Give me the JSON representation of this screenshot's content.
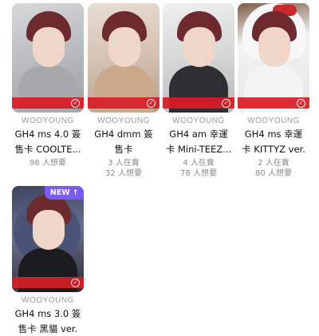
{
  "cards": [
    {
      "brand": "WOOYOUNG",
      "title_line1": "GH4 ms 4.0 簽",
      "title_line2": "售卡 COOLTE...",
      "meta": [
        "98 人想要"
      ]
    },
    {
      "brand": "WOOYOUNG",
      "title_line1": "GH4 dmm 簽",
      "title_line2": "售卡",
      "meta": [
        "3 人在賣",
        "32 人想要"
      ]
    },
    {
      "brand": "WOOYOUNG",
      "title_line1": "GH4 am 幸運",
      "title_line2": "卡 Mini-TEEZ...",
      "meta": [
        "4 人在賣",
        "78 人想要"
      ]
    },
    {
      "brand": "WOOYOUNG",
      "title_line1": "GH4 ms 幸運",
      "title_line2": "卡 KITTYZ ver.",
      "meta": [
        "2 人在賣",
        "80 人想要"
      ]
    },
    {
      "brand": "WOOYOUNG",
      "title_line1": "GH4 ms 3.0 簽",
      "title_line2": "售卡 黑貓 ver.",
      "badge": "NEW",
      "meta": []
    }
  ],
  "colors": {
    "stripe": "#d71d26",
    "badge": "#7b5cf2"
  },
  "icons": {
    "check": "check-circle-icon",
    "badge_arrow": "arrow-up-icon"
  }
}
